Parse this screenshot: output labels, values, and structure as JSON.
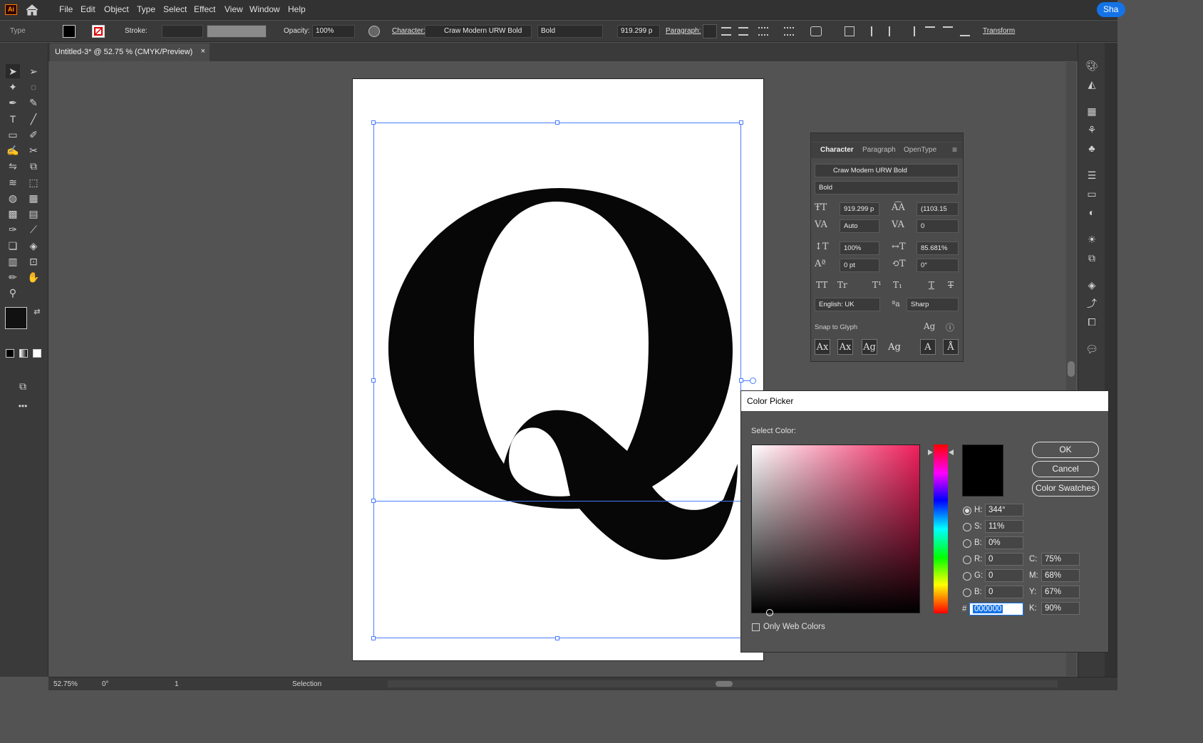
{
  "app": {
    "logo_text": "Ai",
    "share_label": "Sha"
  },
  "menu": [
    "File",
    "Edit",
    "Object",
    "Type",
    "Select",
    "Effect",
    "View",
    "Window",
    "Help"
  ],
  "control_bar": {
    "mode": "Type",
    "stroke_label": "Stroke:",
    "opacity_label": "Opacity:",
    "opacity_value": "100%",
    "character_label": "Character:",
    "font_family": "Craw Modern URW Bold",
    "font_style": "Bold",
    "font_size": "919.299 p",
    "paragraph_label": "Paragraph:",
    "transform_label": "Transform"
  },
  "document_tab": {
    "title": "Untitled-3* @ 52.75 % (CMYK/Preview)",
    "close": "×"
  },
  "artboard": {
    "glyph": "Q"
  },
  "character_panel": {
    "tabs": [
      "Character",
      "Paragraph",
      "OpenType"
    ],
    "font_family": "Craw Modern URW Bold",
    "font_style": "Bold",
    "font_size": "919.299 p",
    "leading": "(1103.15",
    "kerning": "Auto",
    "tracking": "0",
    "vertical_scale": "100%",
    "horizontal_scale": "85.681%",
    "baseline_shift": "0 pt",
    "rotation": "0°",
    "language": "English: UK",
    "antialias": "Sharp",
    "snap_label": "Snap to Glyph"
  },
  "color_picker": {
    "title": "Color Picker",
    "select_label": "Select Color:",
    "ok": "OK",
    "cancel": "Cancel",
    "swatches": "Color Swatches",
    "h": "344°",
    "s": "11%",
    "b": "0%",
    "r": "0",
    "g": "0",
    "bl": "0",
    "hex": "000000",
    "c": "75%",
    "m": "68%",
    "y": "67%",
    "k": "90%",
    "web_only": "Only Web Colors"
  },
  "status": {
    "zoom": "52.75%",
    "rotation": "0°",
    "artboard_num": "1",
    "tool": "Selection"
  },
  "colors": {
    "accent": "#1473e6",
    "selection": "#4a7cff",
    "fill": "#000000"
  }
}
